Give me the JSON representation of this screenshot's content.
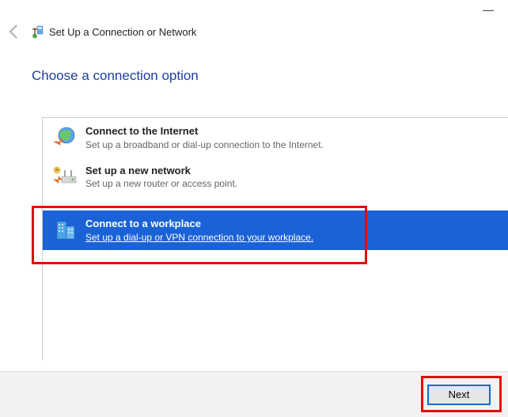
{
  "window": {
    "title": "Set Up a Connection or Network"
  },
  "heading": "Choose a connection option",
  "options": [
    {
      "title": "Connect to the Internet",
      "desc": "Set up a broadband or dial-up connection to the Internet."
    },
    {
      "title": "Set up a new network",
      "desc": "Set up a new router or access point."
    },
    {
      "title": "Connect to a workplace",
      "desc": "Set up a dial-up or VPN connection to your workplace."
    }
  ],
  "footer": {
    "next": "Next"
  }
}
